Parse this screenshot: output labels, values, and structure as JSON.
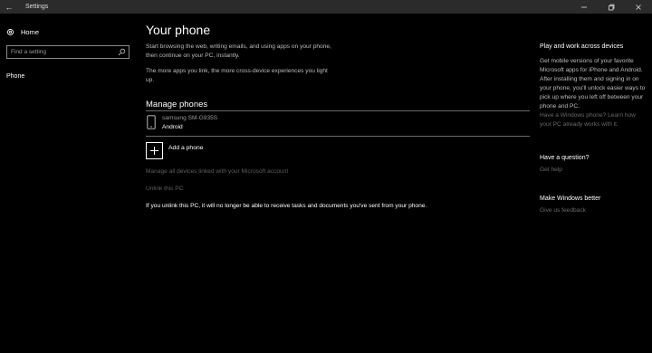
{
  "titlebar": {
    "title": "Settings",
    "back_glyph": "←",
    "minimize_glyph": "–",
    "maximize_glyph": "□",
    "close_glyph": "✕"
  },
  "nav": {
    "home_label": "Home",
    "search_placeholder": "Find a setting",
    "items": [
      {
        "label": "Phone"
      }
    ]
  },
  "main": {
    "title": "Your phone",
    "description1": "Start browsing the web, writing emails, and using apps on your phone, then continue on your PC, instantly.",
    "description2": "The more apps you link, the more cross-device experiences you light up.",
    "manage_title": "Manage phones",
    "device": {
      "name": "samsung SM-G935S",
      "os": "Android"
    },
    "add_phone_label": "Add a phone",
    "manage_link": "Manage all devices linked with your Microsoft account",
    "unlink_link": "Unlink this PC",
    "notice": "If you unlink this PC, it will no longer be able to receive tasks and documents you've sent from your phone."
  },
  "sidebar_right": {
    "play_title": "Play and work across devices",
    "play_text": "Get mobile versions of your favorite Microsoft apps for iPhone and Android. After installing them and signing in on your phone, you'll unlock easier ways to pick up where you left off between your phone and PC.",
    "windows_phone_text": "Have a Windows phone? Learn how your PC already works with it.",
    "question_title": "Have a question?",
    "get_help": "Get help",
    "better_title": "Make Windows better",
    "feedback": "Give us feedback"
  },
  "colors": {
    "background": "#000000",
    "titlebar": "#2b2b2b",
    "dim_link": "#5e5e5e",
    "text_secondary": "#bdbdbd"
  }
}
